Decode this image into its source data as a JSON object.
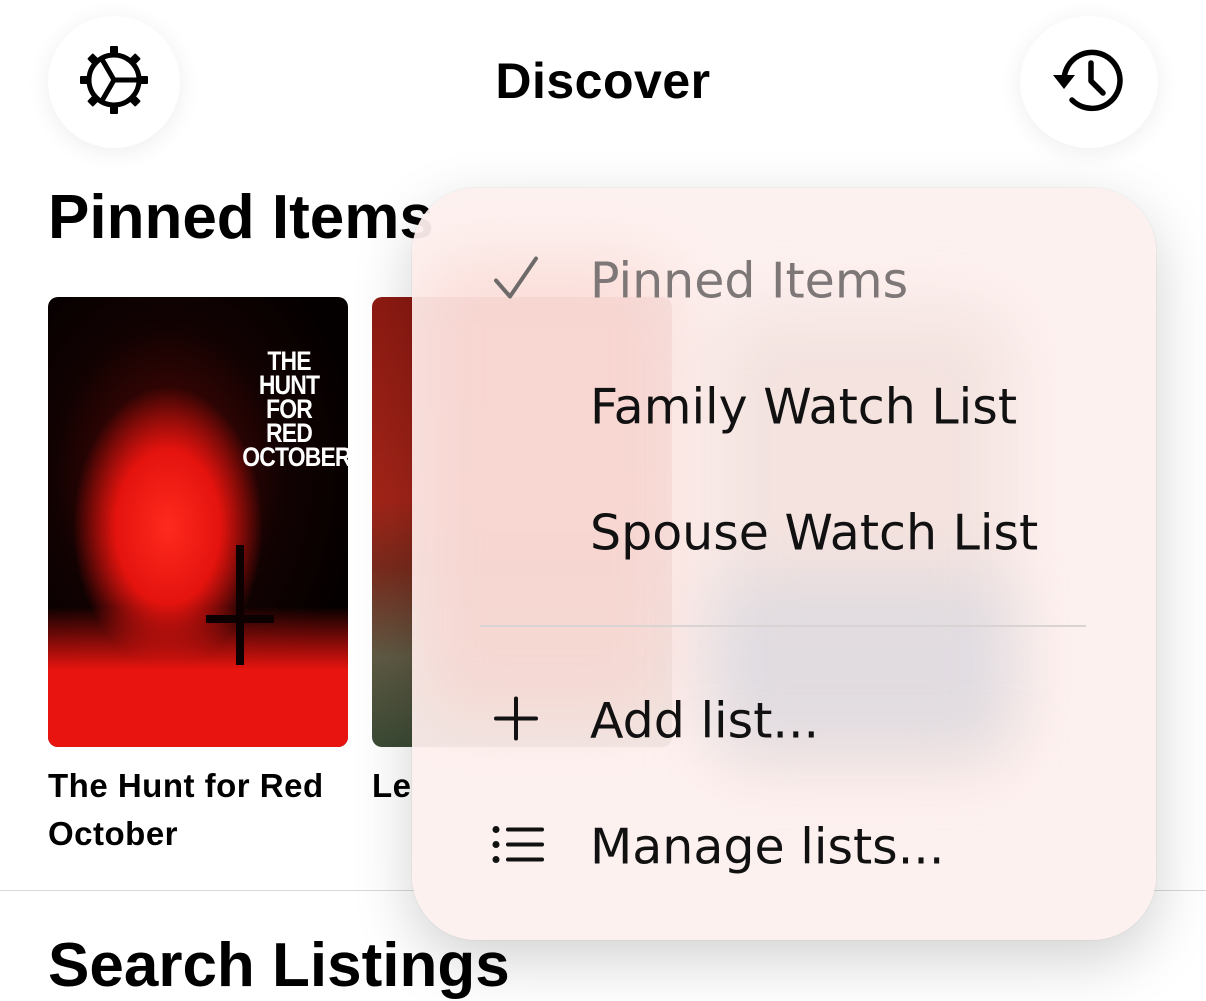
{
  "header": {
    "title": "Discover",
    "settings_icon": "gear-icon",
    "history_icon": "history-clock-icon"
  },
  "pinned": {
    "title": "Pinned Items",
    "items": [
      {
        "poster_title": "THE HUNT FOR RED OCTOBER",
        "caption": "The Hunt for Red October"
      },
      {
        "caption": "Le"
      }
    ]
  },
  "next_section": {
    "title": "Search Listings"
  },
  "menu": {
    "lists": [
      {
        "label": "Pinned Items",
        "selected": true,
        "icon": "checkmark-icon"
      },
      {
        "label": "Family Watch List",
        "selected": false
      },
      {
        "label": "Spouse Watch List",
        "selected": false
      }
    ],
    "actions": [
      {
        "label": "Add list...",
        "icon": "plus-icon"
      },
      {
        "label": "Manage lists...",
        "icon": "list-icon"
      }
    ]
  },
  "colors": {
    "menu_background": "#fdf0ee",
    "selected_text": "#7d7777",
    "poster_red": "#e4130e"
  }
}
